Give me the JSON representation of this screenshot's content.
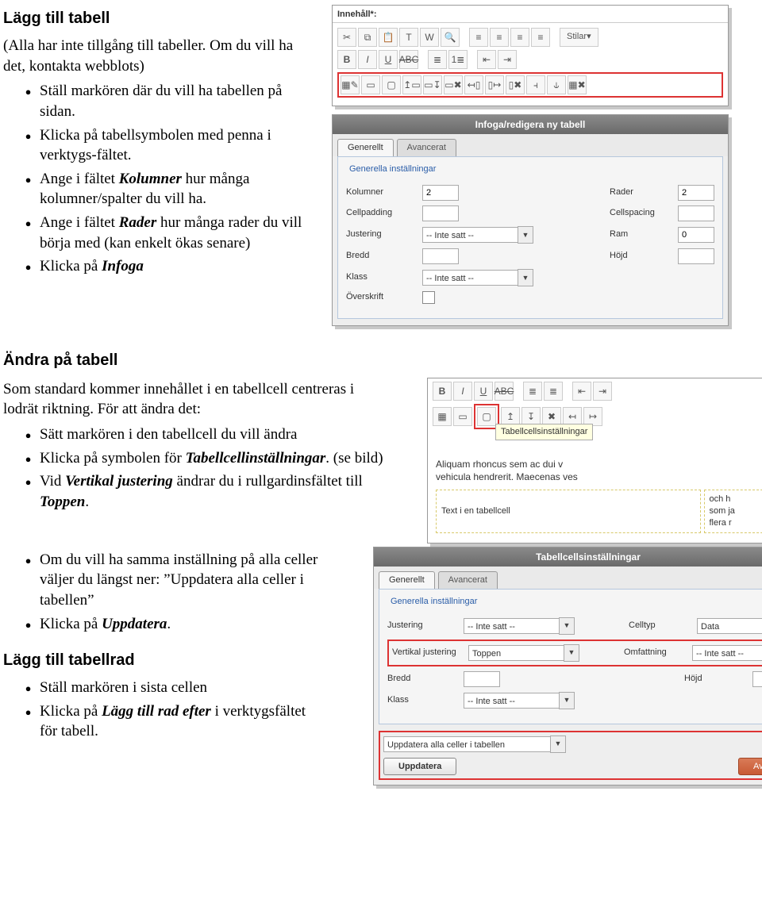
{
  "section1": {
    "heading": "Lägg till tabell",
    "intro": "(Alla har inte tillgång till tabeller. Om du vill ha det, kontakta webblots)",
    "bullets": [
      {
        "pre": "Ställ markören där du vill ha tabellen på sidan.",
        "term": "",
        "post": ""
      },
      {
        "pre": "Klicka på tabellsymbolen med penna i verktygs-fältet.",
        "term": "",
        "post": ""
      },
      {
        "pre": "Ange i fältet ",
        "term": "Kolumner",
        "post": " hur många kolumner/spalter du vill ha."
      },
      {
        "pre": "Ange i fältet ",
        "term": "Rader",
        "post": " hur många rader du vill börja med (kan enkelt ökas senare)"
      },
      {
        "pre": "Klicka på ",
        "term": "Infoga",
        "post": ""
      }
    ],
    "toolbar": {
      "title": "Innehåll*:",
      "styles_btn": "Stilar"
    },
    "dialog": {
      "title": "Infoga/redigera ny tabell",
      "tabs": {
        "a": "Generellt",
        "b": "Avancerat"
      },
      "legend": "Generella inställningar",
      "labels": {
        "kolumner": "Kolumner",
        "rader": "Rader",
        "cellpadding": "Cellpadding",
        "cellspacing": "Cellspacing",
        "justering": "Justering",
        "ram": "Ram",
        "bredd": "Bredd",
        "hojd": "Höjd",
        "klass": "Klass",
        "overskrift": "Överskrift"
      },
      "values": {
        "kolumner": "2",
        "rader": "2",
        "ram": "0",
        "justering": "-- Inte satt --",
        "klass": "-- Inte satt --"
      }
    }
  },
  "section2": {
    "heading": "Ändra på tabell",
    "intro": "Som standard kommer innehållet i en tabellcell centreras i lodrät riktning. För att ändra det:",
    "bullets1": [
      {
        "pre": "Sätt markören i den tabellcell du vill ändra",
        "term": "",
        "post": ""
      },
      {
        "pre": "Klicka på symbolen för ",
        "term": "Tabellcellinställningar",
        "post": ". (se bild)"
      },
      {
        "pre": "Vid ",
        "term": "Vertikal justering",
        "post": " ändrar du i rullgardinsfältet till "
      },
      {
        "pre": "",
        "term": "Toppen",
        "post": "."
      }
    ],
    "bullets2": [
      {
        "pre": "Om du vill ha samma inställning på alla celler väljer du längst ner: ”Uppdatera alla celler i tabellen”",
        "term": "",
        "post": ""
      },
      {
        "pre": "Klicka på ",
        "term": "Uppdatera",
        "post": "."
      }
    ],
    "mini": {
      "tooltip": "Tabellcellsinställningar",
      "sample1": "Aliquam rhoncus sem ac dui v",
      "sample2": "vehicula hendrerit. Maecenas ves",
      "cell_left_1": "",
      "cell_left_2": "Text i en tabellcell",
      "cell_right_1": "och h",
      "cell_right_2": "som ja",
      "cell_right_3": "flera r"
    },
    "dialog": {
      "title": "Tabellcellsinställningar",
      "tabs": {
        "a": "Generellt",
        "b": "Avancerat"
      },
      "legend": "Generella inställningar",
      "labels": {
        "justering": "Justering",
        "celltyp": "Celltyp",
        "vertikal": "Vertikal justering",
        "omfattning": "Omfattning",
        "bredd": "Bredd",
        "hojd": "Höjd",
        "klass": "Klass"
      },
      "values": {
        "justering": "-- Inte satt --",
        "celltyp": "Data",
        "vertikal": "Toppen",
        "omfattning": "-- Inte satt --",
        "klass": "-- Inte satt --"
      },
      "update_all": "Uppdatera alla celler i tabellen",
      "ok": "Uppdatera",
      "cancel": "Avbryt"
    }
  },
  "section3": {
    "heading": "Lägg till tabellrad",
    "bullets": [
      {
        "pre": "Ställ markören i sista cellen",
        "term": "",
        "post": ""
      },
      {
        "pre": "Klicka på ",
        "term": "Lägg till rad efter",
        "post": " i verktygsfältet för tabell."
      }
    ]
  }
}
